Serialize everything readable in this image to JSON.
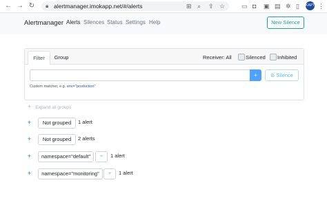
{
  "browser": {
    "url": "alertmanager.imokapp.net/#/alerts",
    "avatar_label": "KAPT"
  },
  "navbar": {
    "brand": "Alertmanager",
    "links": [
      "Alerts",
      "Silences",
      "Status",
      "Settings",
      "Help"
    ],
    "new_silence": "New Silence"
  },
  "filter": {
    "tabs": [
      "Filter",
      "Group"
    ],
    "receiver": "Receiver: All",
    "silenced": "Silenced",
    "inhibited": "Inhibited",
    "plus": "+",
    "silence": "Silence",
    "hint_text": "Custom matcher, e.g.",
    "hint_example": "env=\"production\""
  },
  "expand_all": "Expand all groups",
  "groups": [
    {
      "label": "Not grouped",
      "count": "1 alert"
    },
    {
      "label": "Not grouped",
      "count": "2 alerts"
    },
    {
      "label": "namespace=\"default\"",
      "plus": "+",
      "count": "1 alert"
    },
    {
      "label": "namespace=\"monitoring\"",
      "plus": "+",
      "count": "1 alert"
    }
  ],
  "colors": {
    "accent": "#17a2b8",
    "primary": "#4da3ff",
    "navbar_bg": "#f8f9fa"
  }
}
